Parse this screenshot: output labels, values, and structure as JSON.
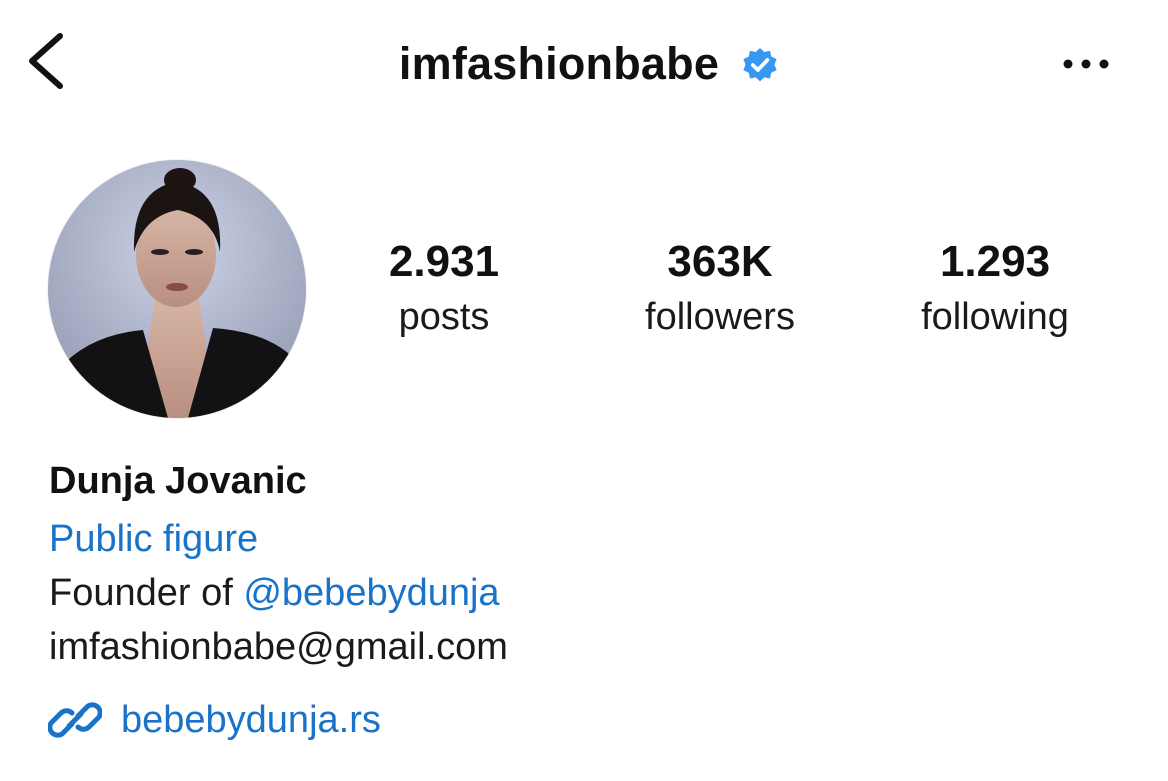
{
  "header": {
    "username": "imfashionbabe",
    "back_icon": "chevron-left-icon",
    "verified_icon": "verified-badge-icon",
    "more_icon": "more-horizontal-icon"
  },
  "stats": {
    "posts": {
      "count": "2.931",
      "label": "posts"
    },
    "followers": {
      "count": "363K",
      "label": "followers"
    },
    "following": {
      "count": "1.293",
      "label": "following"
    }
  },
  "bio": {
    "name": "Dunja Jovanic",
    "category": "Public figure",
    "line1_prefix": "Founder of ",
    "line1_mention": "@bebebydunja",
    "email": "imfashionbabe@gmail.com",
    "link_icon": "link-icon",
    "link_text": "bebebydunja.rs"
  },
  "colors": {
    "text": "#111111",
    "link": "#1a73c9",
    "verified": "#3897f0"
  }
}
